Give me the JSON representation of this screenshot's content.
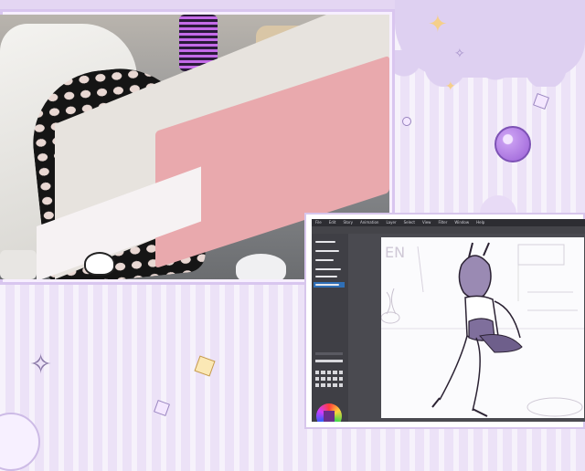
{
  "layout_name": "stream-overlay",
  "colors": {
    "background": "#ece2f7",
    "frame_border": "#d9c6ef",
    "accent_purple": "#9a5fd6",
    "sparkle_gold": "#f5cf8a",
    "app_dark": "#3a3a3f",
    "app_highlight": "#2f6fb6"
  },
  "webcam": {
    "icons": [
      "lamp-icon",
      "can-icon",
      "cat-keyboard-icon"
    ]
  },
  "art_app": {
    "menu_items": [
      "File",
      "Edit",
      "Story",
      "Animation",
      "Layer",
      "Select",
      "View",
      "Filter",
      "Window",
      "Help"
    ],
    "canvas_text": "EN",
    "brush_count": 6,
    "selected_brush_index": 5
  },
  "decorations": [
    "sparkle-icon",
    "bubble-icon",
    "cube-icon"
  ]
}
